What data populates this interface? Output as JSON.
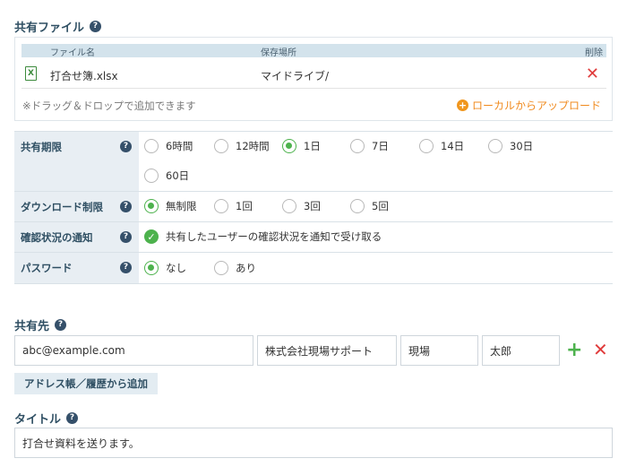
{
  "shared_files": {
    "title": "共有ファイル",
    "help": "?",
    "columns": {
      "name": "ファイル名",
      "location": "保存場所",
      "delete": "削除"
    },
    "files": [
      {
        "icon": "excel-file-icon",
        "icon_glyph": "X",
        "name": "打合せ簿.xlsx",
        "location": "マイドライブ/",
        "delete_glyph": "✕"
      }
    ],
    "drop_hint": "※ドラッグ＆ドロップで追加できます",
    "upload_label": "ローカルからアップロード",
    "upload_glyph": "+"
  },
  "settings": {
    "expiry": {
      "label": "共有期限",
      "options": [
        "6時間",
        "12時間",
        "1日",
        "7日",
        "14日",
        "30日",
        "60日"
      ],
      "selected": "1日"
    },
    "download_limit": {
      "label": "ダウンロード制限",
      "options": [
        "無制限",
        "1回",
        "3回",
        "5回"
      ],
      "selected": "無制限"
    },
    "notify": {
      "label": "確認状況の通知",
      "text": "共有したユーザーの確認状況を通知で受け取る",
      "checked": true,
      "glyph": "✓"
    },
    "password": {
      "label": "パスワード",
      "options": [
        "なし",
        "あり"
      ],
      "selected": "なし"
    }
  },
  "recipients": {
    "title": "共有先",
    "email": "abc@example.com",
    "company": "株式会社現場サポート",
    "last_name": "現場",
    "first_name": "太郎",
    "add_glyph": "+",
    "remove_glyph": "✕",
    "address_book_label": "アドレス帳／履歴から追加"
  },
  "subject": {
    "title": "タイトル",
    "value": "打合せ資料を送ります。"
  },
  "colors": {
    "accent_green": "#4db24d",
    "accent_orange": "#f08a1e",
    "danger_red": "#e03c3c",
    "header_navy": "#2f4f63"
  }
}
